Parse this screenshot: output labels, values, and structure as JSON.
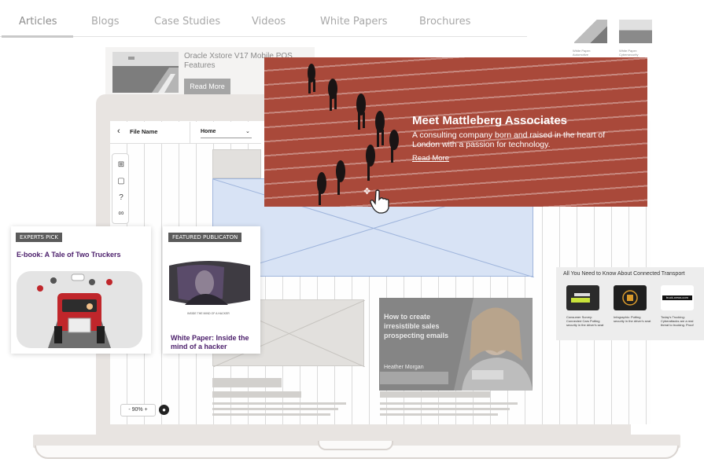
{
  "tabs": [
    {
      "label": "Articles",
      "active": true
    },
    {
      "label": "Blogs",
      "active": false
    },
    {
      "label": "Case Studies",
      "active": false
    },
    {
      "label": "Videos",
      "active": false
    },
    {
      "label": "White Papers",
      "active": false
    },
    {
      "label": "Brochures",
      "active": false
    }
  ],
  "article_card": {
    "title": "Oracle Xstore V17 Mobile POS Features",
    "button": "Read More"
  },
  "thumbs": [
    {
      "caption": "White Paper: Automotive"
    },
    {
      "caption": "White Paper: Cybersecurity"
    }
  ],
  "editor": {
    "file_name": "File Name",
    "page_select": "Home",
    "zoom": "90%"
  },
  "hero": {
    "title": "Meet Mattleberg Associates",
    "text": "A consulting company born and raised in the heart of London with a passion for technology.",
    "link": "Read More"
  },
  "expert_card": {
    "tag": "EXPERTS PICK",
    "title": "E-book: A Tale of Two Truckers"
  },
  "featured_card": {
    "tag": "FEATURED PUBLICATON",
    "image_caption": "INSIDE THE MIND OF A HACKER",
    "title": "White Paper: Inside the mind of a hacker"
  },
  "video_card": {
    "text": "How to create irresistible sales prospecting emails",
    "author": "Heather Morgan"
  },
  "transport_card": {
    "title": "All You Need to Know About Connected Transport",
    "items": [
      {
        "caption": "Consumer Survey: Connected Cars Putting security in the driver's seat"
      },
      {
        "caption": "Infographic: Putting security in the driver's seat"
      },
      {
        "caption": "Today's Trucking: Cyberattacks are a real threat to trucking. Proof"
      }
    ],
    "logo_text": "truck-news.com"
  },
  "colors": {
    "hero_bg": "#a9493a",
    "accent_purple": "#4a1d6a",
    "blue_placeholder": "#d8e3f5"
  }
}
